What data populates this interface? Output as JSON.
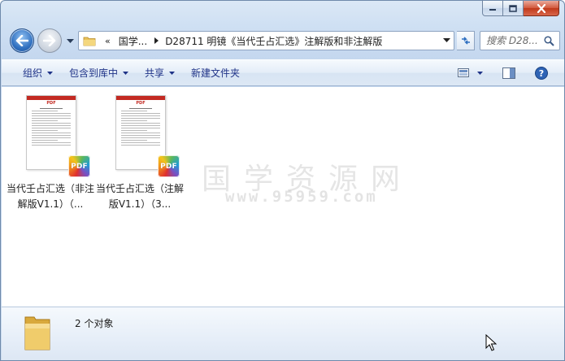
{
  "window": {
    "caption_buttons": [
      "minimize-icon",
      "maximize-icon",
      "close-icon"
    ]
  },
  "address": {
    "overflow_label": "«",
    "crumbs": [
      "国学...",
      "D28711 明镜《当代壬占汇选》注解版和非注解版"
    ],
    "search_placeholder": "搜索 D28..."
  },
  "toolbar": {
    "organize": "组织",
    "include_in_library": "包含到库中",
    "share": "共享",
    "new_folder": "新建文件夹"
  },
  "files": [
    {
      "name": "当代壬占汇选（非注解版V1.1）（...",
      "type_badge": "PDF",
      "thumb_label": "PDF"
    },
    {
      "name": "当代壬占汇选（注解版V1.1）（3...",
      "type_badge": "PDF",
      "thumb_label": "PDF"
    }
  ],
  "watermark": {
    "text": "国学资源网",
    "url": "www.95959.com"
  },
  "status": {
    "item_count": "2 个对象"
  },
  "colors": {
    "accent": "#1e3287",
    "pdf_red": "#c32a22",
    "folder_yellow": "#e8c15a"
  }
}
